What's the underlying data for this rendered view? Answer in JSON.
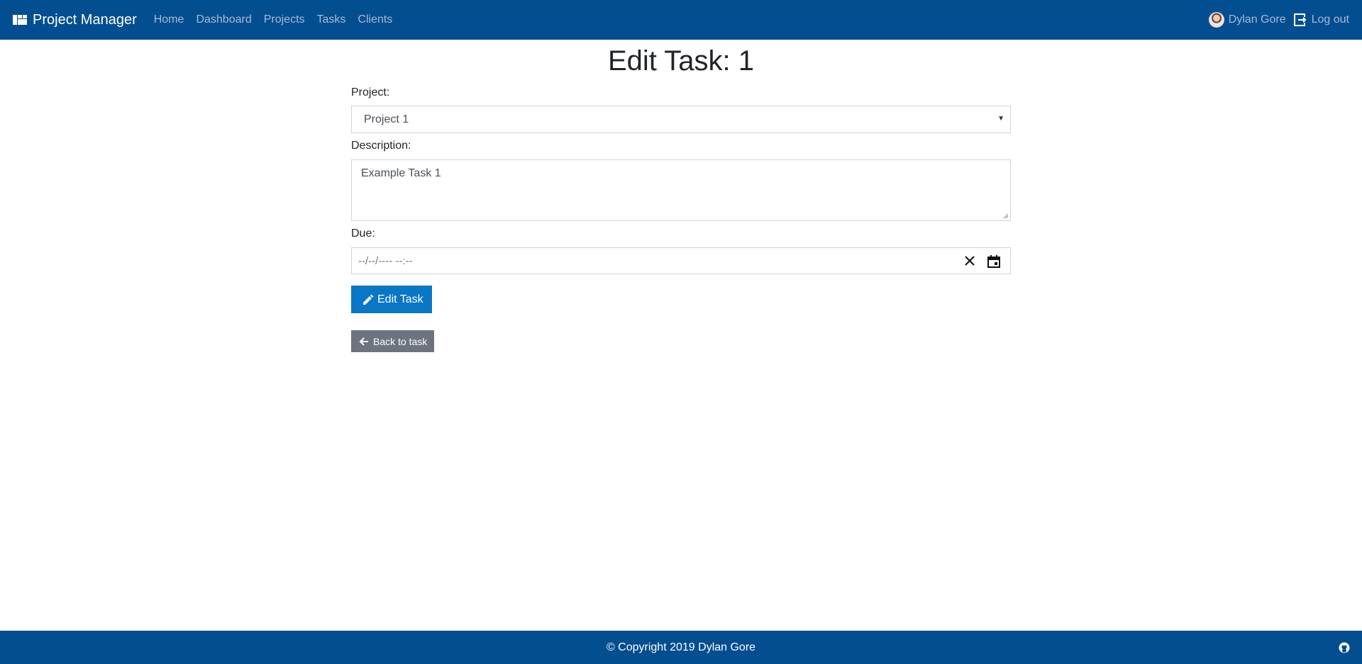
{
  "navbar": {
    "brand": "Project Manager",
    "brand_icon": "dashboard-icon",
    "links": [
      "Home",
      "Dashboard",
      "Projects",
      "Tasks",
      "Clients"
    ],
    "user_name": "Dylan Gore",
    "logout_label": "Log out"
  },
  "page": {
    "title": "Edit Task: 1"
  },
  "form": {
    "project_label": "Project:",
    "project_value": "Project 1",
    "description_label": "Description:",
    "description_value": "Example Task 1",
    "due_label": "Due:",
    "due_placeholder": "--/--/---- --:--",
    "submit_label": "Edit Task",
    "back_label": "Back to task"
  },
  "footer": {
    "copyright": "© Copyright 2019 Dylan Gore"
  },
  "colors": {
    "navbar": "#034e91",
    "primary": "#0a76c6",
    "secondary": "#6c757d"
  }
}
